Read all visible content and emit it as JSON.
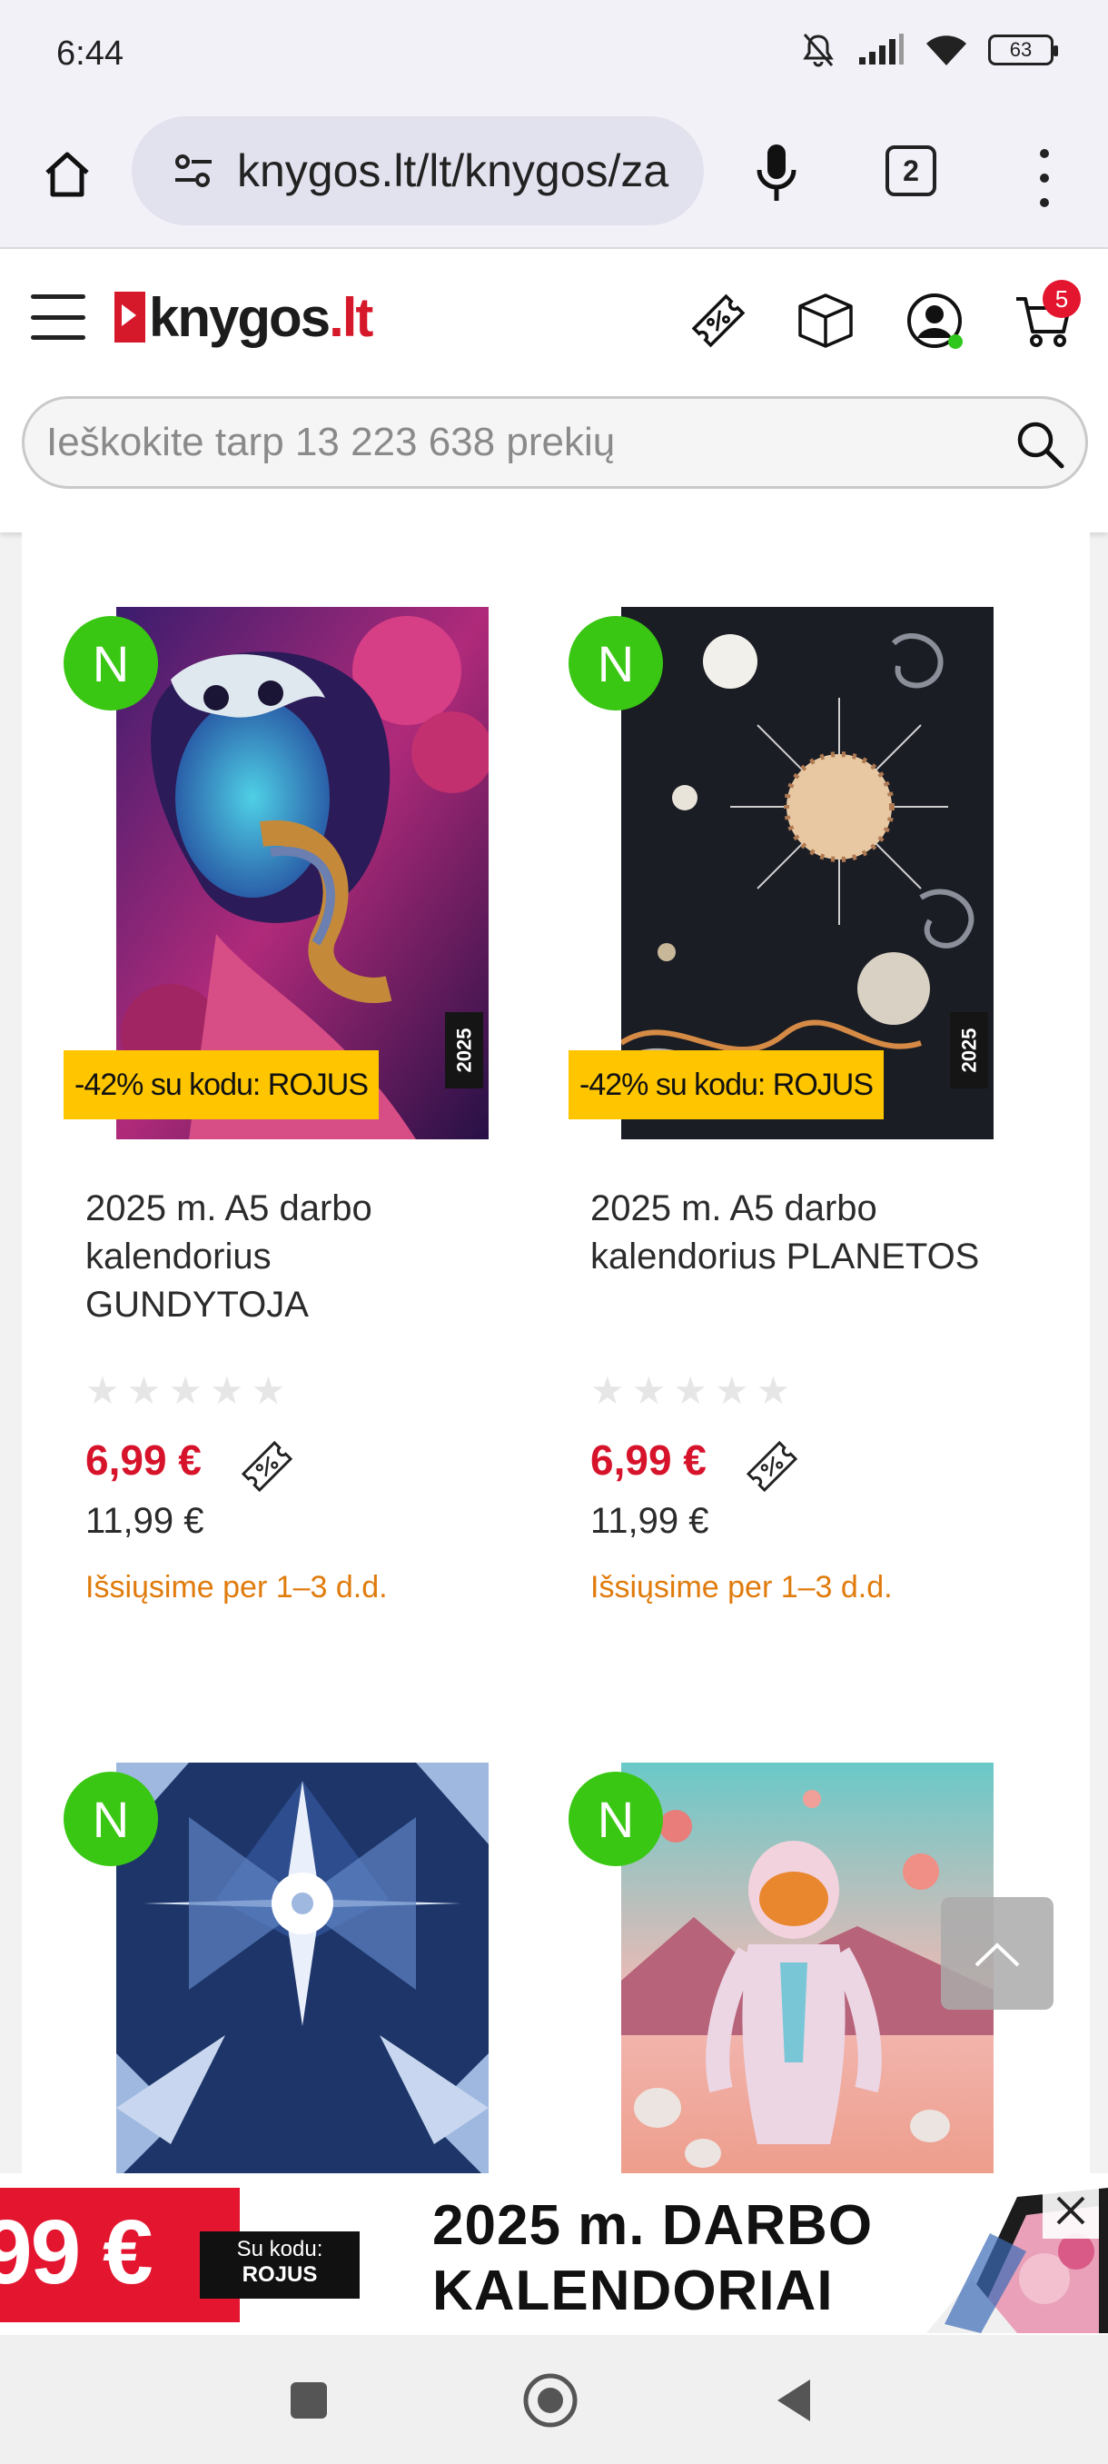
{
  "status_bar": {
    "time": "6:44",
    "battery": "63"
  },
  "browser": {
    "url": "knygos.lt/lt/knygos/za",
    "tab_count": "2"
  },
  "site": {
    "logo_text": "knygos",
    "logo_domain": ".lt",
    "cart_count": "5",
    "search_placeholder": "Ieškokite tarp 13 223 638 prekių"
  },
  "products": [
    {
      "badge": "N",
      "promo": "-42% su kodu: ROJUS",
      "year": "2025",
      "title": "2025 m. A5 darbo kalendorius GUNDYTOJA",
      "price_new": "6,99 €",
      "price_old": "11,99 €",
      "shipping": "Išsiųsime per 1–3 d.d.",
      "rating": 0
    },
    {
      "badge": "N",
      "promo": "-42% su kodu: ROJUS",
      "year": "2025",
      "title": "2025 m. A5 darbo kalendorius PLANETOS",
      "price_new": "6,99 €",
      "price_old": "11,99 €",
      "shipping": "Išsiųsime per 1–3 d.d.",
      "rating": 0
    },
    {
      "badge": "N"
    },
    {
      "badge": "N"
    }
  ],
  "banner": {
    "price_fragment": "99 €",
    "code_label": "Su kodu:",
    "code_value": "ROJUS",
    "headline_line1": "2025 m. DARBO",
    "headline_line2": "KALENDORIAI"
  },
  "colors": {
    "brand_red": "#d6132b",
    "new_badge_green": "#3ac714",
    "promo_yellow": "#ffc600",
    "shipping_orange": "#e07b0c"
  }
}
